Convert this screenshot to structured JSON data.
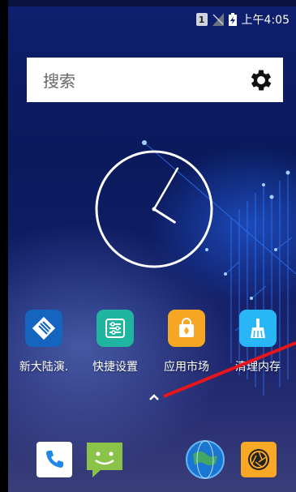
{
  "status_bar": {
    "sim_label": "1",
    "time": "上午4:05",
    "icons": [
      "sim-icon",
      "no-signal-icon",
      "battery-charging-icon"
    ]
  },
  "search": {
    "placeholder": "搜索",
    "settings_icon": "gear-icon"
  },
  "clock": {
    "hour": 4,
    "minute": 5
  },
  "apps": [
    {
      "label": "新大陆演.",
      "icon": "newland-demo-icon",
      "color": "#1565c0"
    },
    {
      "label": "快捷设置",
      "icon": "quick-settings-icon",
      "color": "#1fb5a0"
    },
    {
      "label": "应用市场",
      "icon": "app-market-icon",
      "color": "#f5a623"
    },
    {
      "label": "清理内存",
      "icon": "broom-icon",
      "color": "#29b6f6"
    }
  ],
  "app_drawer": {
    "icon": "chevron-up-icon"
  },
  "dock": [
    {
      "icon": "phone-icon",
      "color": "#1e88e5"
    },
    {
      "icon": "messaging-icon",
      "color": "#8bc34a"
    },
    {
      "icon": "browser-globe-icon",
      "color": "#1976d2"
    },
    {
      "icon": "camera-icon",
      "color": "#f9a825"
    }
  ],
  "colors": {
    "annotation_arrow": "#e8161a"
  }
}
